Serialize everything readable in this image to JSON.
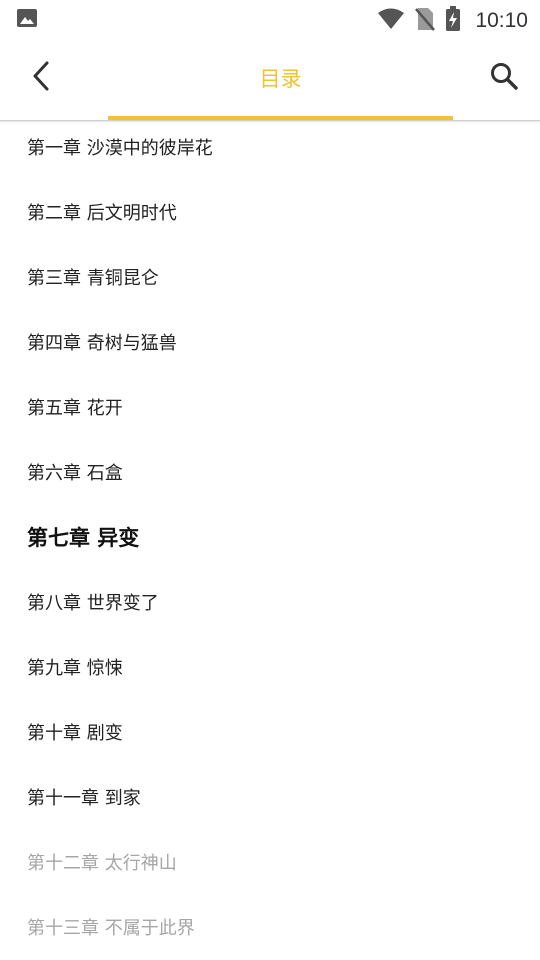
{
  "status_bar": {
    "time": "10:10",
    "icons": [
      "gallery-icon",
      "wifi-icon",
      "no-sim-icon",
      "battery-charging-icon"
    ]
  },
  "header": {
    "title": "目录",
    "accent_color": "#f2c230",
    "back_icon": "chevron-left-icon",
    "search_icon": "search-icon"
  },
  "chapters": [
    {
      "label": "第一章 沙漠中的彼岸花",
      "state": "normal"
    },
    {
      "label": "第二章 后文明时代",
      "state": "normal"
    },
    {
      "label": "第三章 青铜昆仑",
      "state": "normal"
    },
    {
      "label": "第四章 奇树与猛兽",
      "state": "normal"
    },
    {
      "label": "第五章 花开",
      "state": "normal"
    },
    {
      "label": "第六章 石盒",
      "state": "normal"
    },
    {
      "label": "第七章 异变",
      "state": "current"
    },
    {
      "label": "第八章 世界变了",
      "state": "normal"
    },
    {
      "label": "第九章 惊悚",
      "state": "normal"
    },
    {
      "label": "第十章 剧变",
      "state": "normal"
    },
    {
      "label": "第十一章 到家",
      "state": "normal"
    },
    {
      "label": "第十二章 太行神山",
      "state": "locked"
    },
    {
      "label": "第十三章 不属于此界",
      "state": "locked"
    }
  ]
}
